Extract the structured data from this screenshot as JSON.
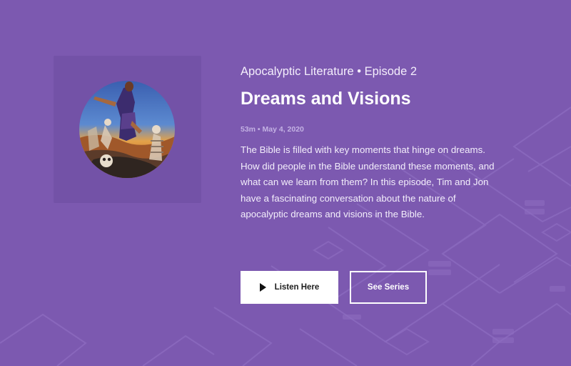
{
  "episode": {
    "series_line": "Apocalyptic Literature • Episode 2",
    "title": "Dreams and Visions",
    "meta": "53m • May 4, 2020",
    "description": "The Bible is filled with key moments that hinge on dreams. How did people in the Bible understand these moments, and what can we learn from them? In this episode, Tim and Jon have a fascinating conversation about the nature of apocalyptic dreams and visions in the Bible."
  },
  "actions": {
    "listen_label": "Listen Here",
    "listen_icon": "play-icon",
    "series_label": "See Series"
  },
  "colors": {
    "background": "#7c59b0",
    "art_panel": "#7352a7",
    "meta_text": "#c3b1e3",
    "button_fill": "#ffffff"
  }
}
